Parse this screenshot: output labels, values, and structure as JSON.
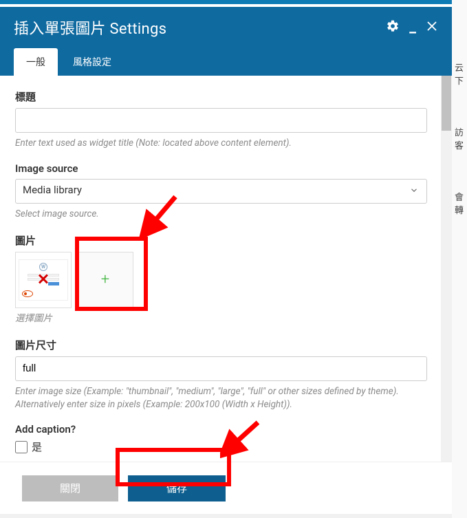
{
  "header": {
    "title": "插入單張圖片 Settings",
    "tabs": [
      {
        "label": "一般",
        "active": true
      },
      {
        "label": "風格設定",
        "active": false
      }
    ]
  },
  "fields": {
    "title_label": "標題",
    "title_value": "",
    "title_hint": "Enter text used as widget title (Note: located above content element).",
    "source_label": "Image source",
    "source_value": "Media library",
    "source_hint": "Select image source.",
    "image_label": "圖片",
    "image_hint": "選擇圖片",
    "size_label": "圖片尺寸",
    "size_value": "full",
    "size_hint": "Enter image size (Example: \"thumbnail\", \"medium\", \"large\", \"full\" or other sizes defined by theme). Alternatively enter size in pixels (Example: 200x100 (Width x Height)).",
    "caption_label": "Add caption?",
    "caption_option": "是"
  },
  "footer": {
    "close": "關閉",
    "save": "儲存"
  },
  "sidebar_hints": [
    "云下",
    "訪客",
    "會轉"
  ]
}
